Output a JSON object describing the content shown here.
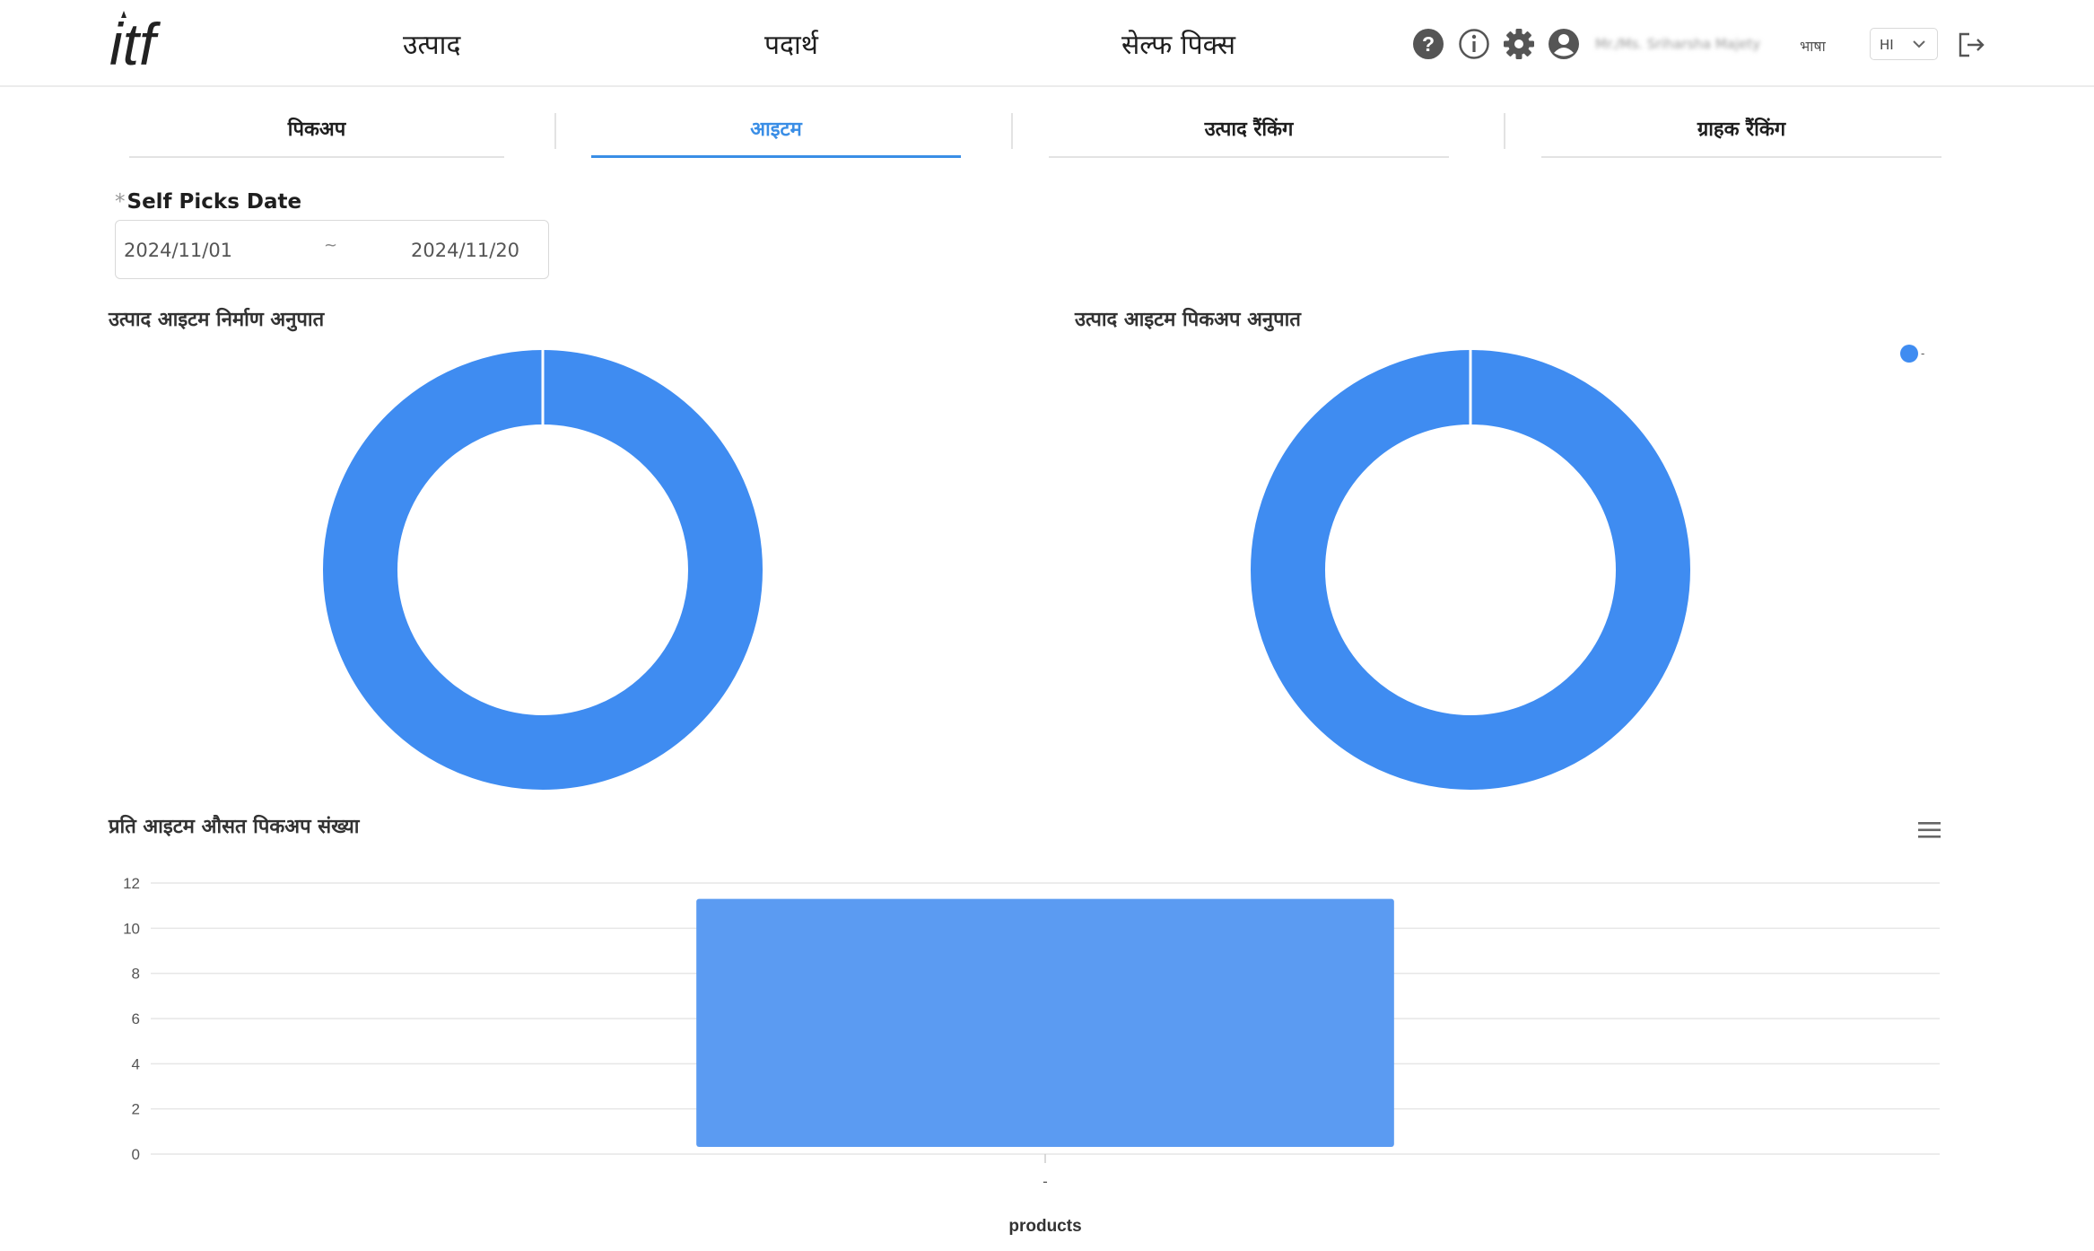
{
  "app": {
    "logo_text": "itf"
  },
  "nav": {
    "items": [
      {
        "label": "उत्पाद"
      },
      {
        "label": "पदार्थ"
      },
      {
        "label": "सेल्फ पिक्स"
      }
    ]
  },
  "header": {
    "user_name": "Mr./Ms. Sriharsha Majety",
    "lang_label": "भाषा",
    "lang_value": "HI",
    "icons": [
      "help-icon",
      "info-icon",
      "gear-icon",
      "user-icon",
      "chevron-down-icon",
      "logout-icon"
    ]
  },
  "tabs": [
    {
      "label": "पिकअप",
      "active": false
    },
    {
      "label": "आइटम",
      "active": true
    },
    {
      "label": "उत्पाद रैंकिंग",
      "active": false
    },
    {
      "label": "ग्राहक रैंकिंग",
      "active": false
    }
  ],
  "filter": {
    "label": "Self Picks Date",
    "required_mark": "*",
    "start": "2024/11/01",
    "separator": "~",
    "end": "2024/11/20"
  },
  "colors": {
    "accent": "#3a8ee6",
    "donut": "#3f8cf1",
    "bar": "#5b9bf2"
  },
  "chart_data": [
    {
      "type": "pie",
      "title": "उत्पाद आइटम निर्माण अनुपात",
      "variant": "donut",
      "categories": [
        "-"
      ],
      "values": [
        1
      ]
    },
    {
      "type": "pie",
      "title": "उत्पाद आइटम पिकअप अनुपात",
      "variant": "donut",
      "categories": [
        "-"
      ],
      "values": [
        1
      ],
      "legend": {
        "position": "top-right",
        "entries": [
          "-"
        ]
      }
    },
    {
      "type": "bar",
      "title": "प्रति आइटम औसत पिकअप संख्या",
      "categories": [
        "-"
      ],
      "values": [
        11.3
      ],
      "xlabel": "products",
      "ylabel": "",
      "ylim": [
        0,
        12
      ],
      "yticks": [
        0,
        2,
        4,
        6,
        8,
        10,
        12
      ],
      "grid": true,
      "menu_icon": "menu-icon"
    }
  ]
}
